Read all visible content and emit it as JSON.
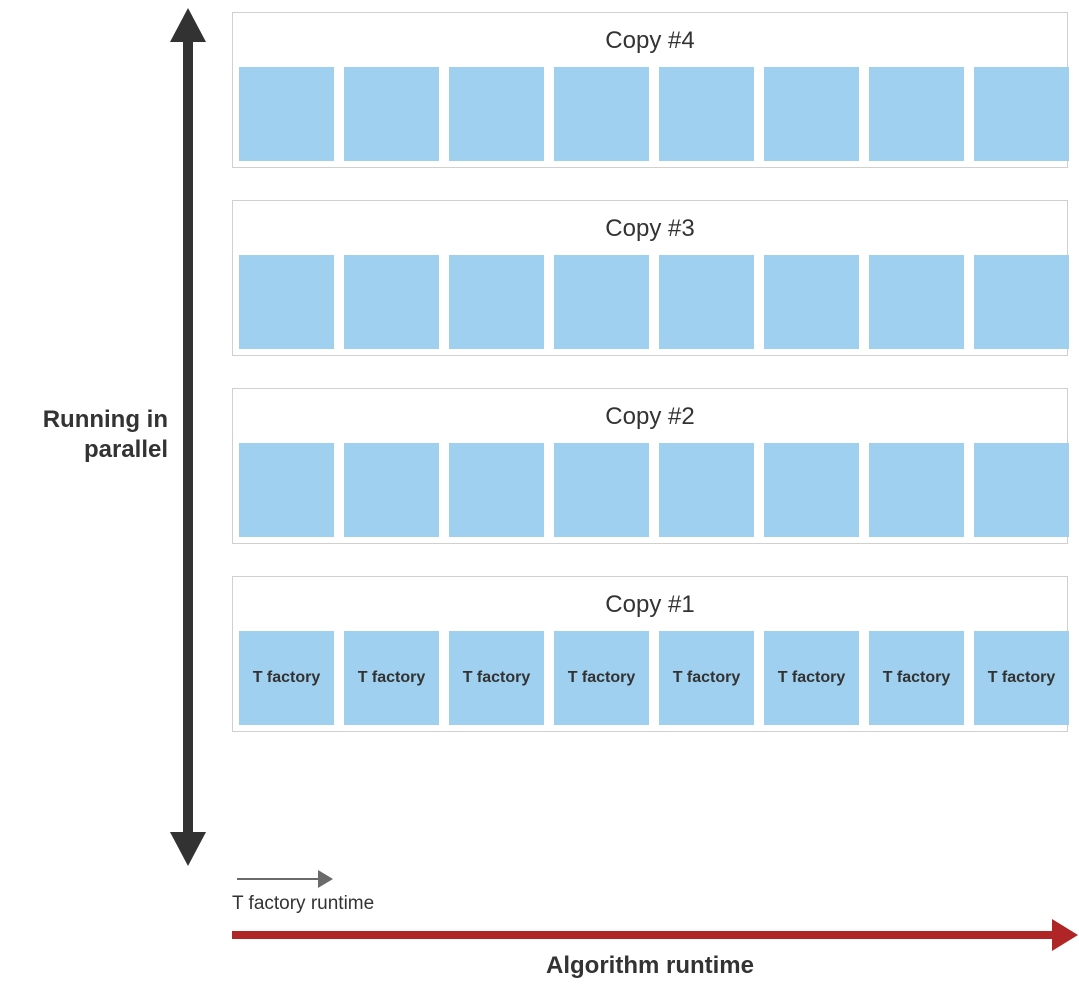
{
  "axes": {
    "y_label": "Running in parallel",
    "x_label": "Algorithm runtime",
    "small_label": "T factory runtime"
  },
  "lanes": [
    {
      "title": "Copy #4",
      "tiles": [
        "",
        "",
        "",
        "",
        "",
        "",
        "",
        ""
      ]
    },
    {
      "title": "Copy #3",
      "tiles": [
        "",
        "",
        "",
        "",
        "",
        "",
        "",
        ""
      ]
    },
    {
      "title": "Copy #2",
      "tiles": [
        "",
        "",
        "",
        "",
        "",
        "",
        "",
        ""
      ]
    },
    {
      "title": "Copy #1",
      "tiles": [
        "T factory",
        "T factory",
        "T factory",
        "T factory",
        "T factory",
        "T factory",
        "T factory",
        "T factory"
      ]
    }
  ],
  "colors": {
    "tile": "#9fd0ef",
    "axis_dark": "#323232",
    "axis_red": "#b02525",
    "axis_gray": "#6a6a6a",
    "lane_border": "#d0d0d0"
  },
  "chart_data": {
    "type": "table",
    "description": "Four parallel copies of T factories running over algorithm runtime. Each copy contains 8 sequential T factory invocations. X dimension is algorithm runtime; Y dimension is parallel copies.",
    "parallel_copies": 4,
    "invocations_per_copy": 8,
    "tile_label": "T factory",
    "x_axis": "Algorithm runtime",
    "y_axis": "Running in parallel",
    "unit_duration_label": "T factory runtime"
  }
}
